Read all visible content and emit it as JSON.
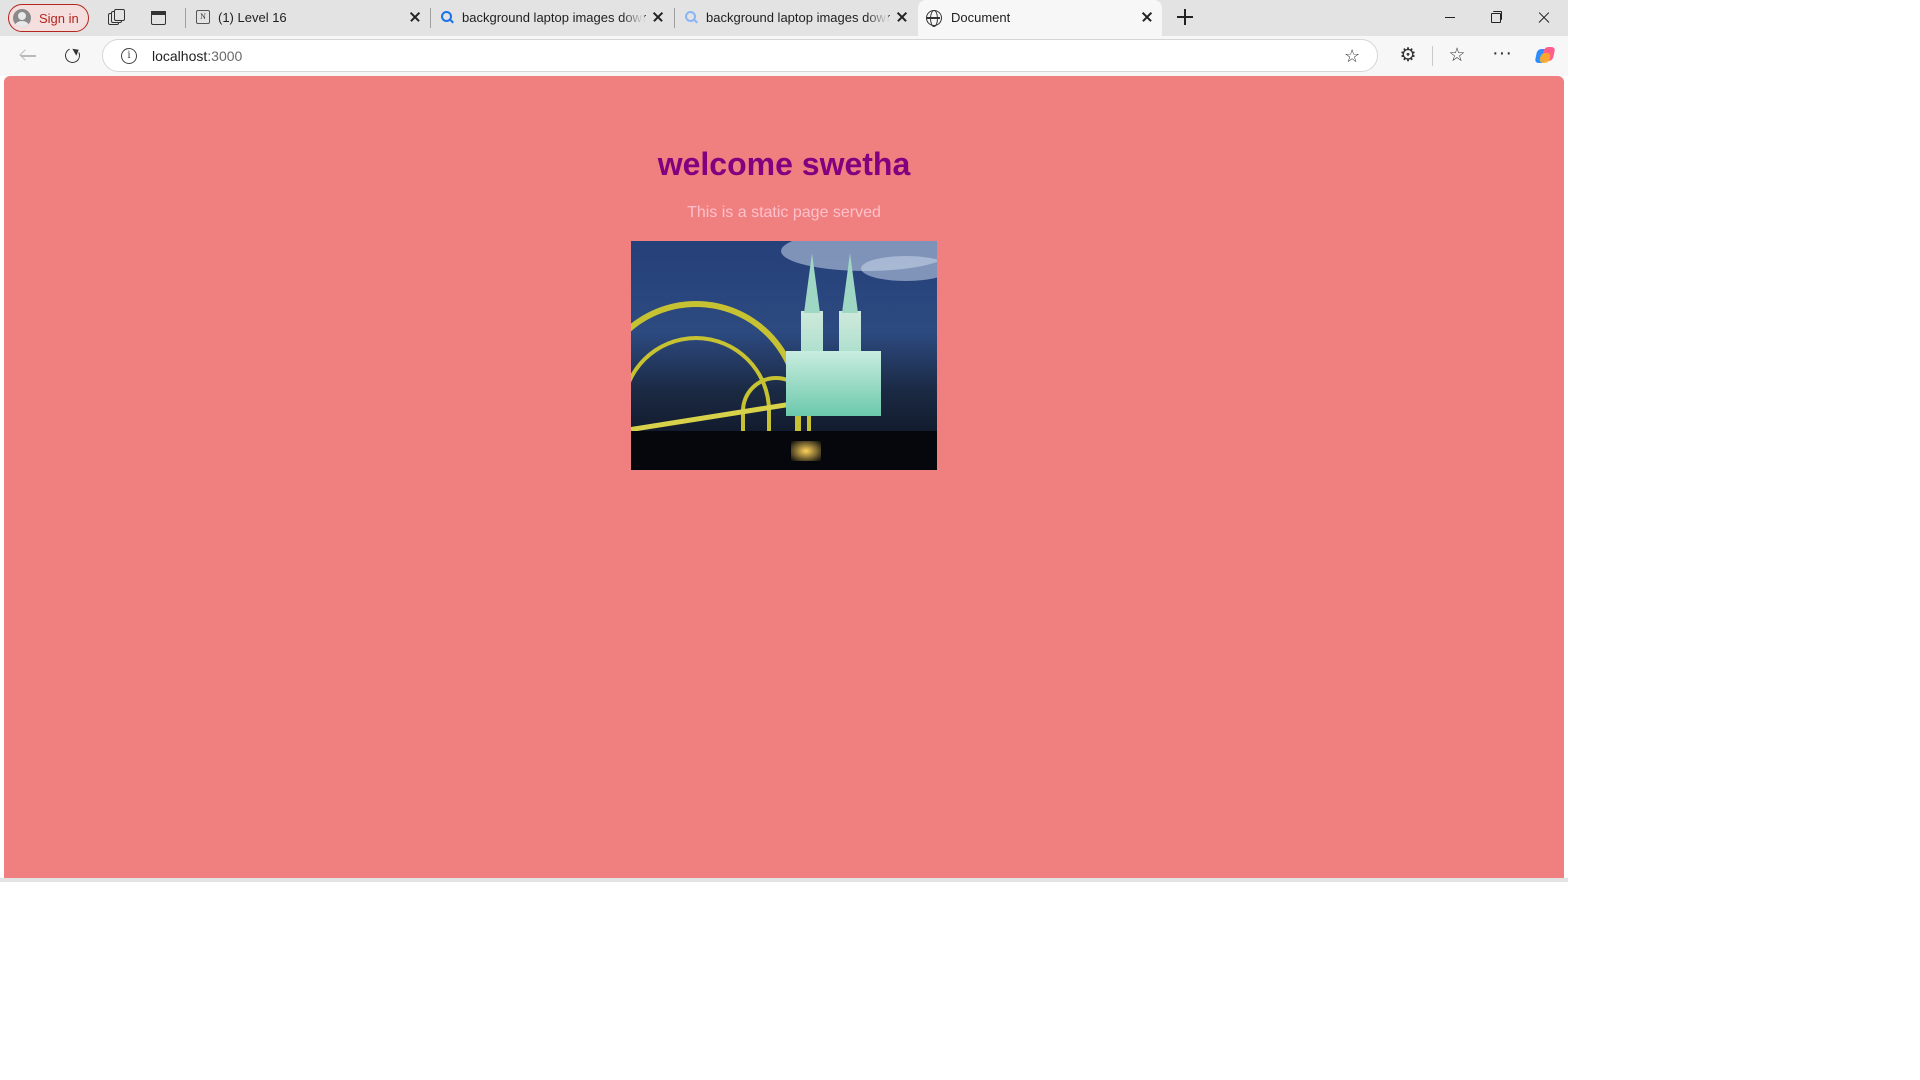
{
  "browser": {
    "signin_label": "Sign in",
    "tabs": [
      {
        "title": "(1) Level 16",
        "favicon": "notion-icon",
        "active": false
      },
      {
        "title": "background laptop images downl",
        "favicon": "search-icon",
        "active": false
      },
      {
        "title": "background laptop images downl",
        "favicon": "search-icon",
        "active": false
      },
      {
        "title": "Document",
        "favicon": "globe-icon",
        "active": true
      }
    ],
    "tab1_favicon_text": "N",
    "url_host": "localhost",
    "url_port": ":3000",
    "icons": {
      "info": "i",
      "star": "☆",
      "extensions": "⚙",
      "favorites": "☆",
      "more": "···"
    }
  },
  "page": {
    "heading": "welcome swetha",
    "subtext": "This is a static page served",
    "background_color": "#f08080",
    "heading_color": "#800080",
    "subtext_color": "#ffc0cb",
    "image_description": "Cologne Cathedral and Hohenzollern Bridge at night"
  }
}
